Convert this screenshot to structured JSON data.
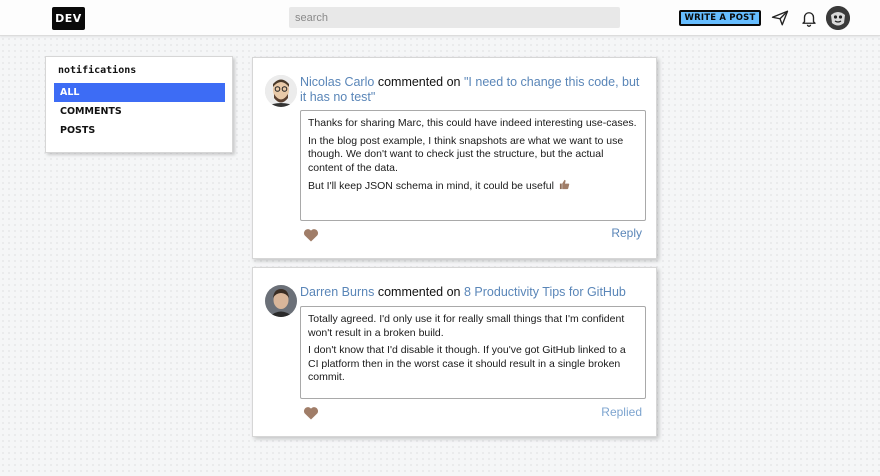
{
  "topbar": {
    "logo": "DEV",
    "search_placeholder": "search",
    "write_post_label": "WRITE A POST",
    "icons": [
      "send-icon",
      "bell-icon",
      "user-avatar"
    ]
  },
  "sidebar": {
    "title": "notifications",
    "items": [
      {
        "label": "ALL",
        "active": true
      },
      {
        "label": "COMMENTS",
        "active": false
      },
      {
        "label": "POSTS",
        "active": false
      }
    ]
  },
  "notifications": [
    {
      "author": "Nicolas Carlo",
      "action": "commented on",
      "post_title": "\"I need to change this code, but it has no test\"",
      "comment_paragraphs": [
        "Thanks for sharing Marc, this could have indeed interesting use-cases.",
        "In the blog post example, I think snapshots are what we want to use though. We don't want to check just the structure, but the actual content of the data.",
        "But I'll keep JSON schema in mind, it could be useful"
      ],
      "reply_label": "Reply"
    },
    {
      "author": "Darren Burns",
      "action": "commented on",
      "post_title": "8 Productivity Tips for GitHub",
      "comment_paragraphs": [
        "Totally agreed. I'd only use it for really small things that I'm confident won't result in a broken build.",
        "I don't know that I'd disable it though. If you've got GitHub linked to a CI platform then in the worst case it should result in a single broken commit."
      ],
      "reply_label": "Replied"
    }
  ],
  "colors": {
    "accent": "#3d6cf5",
    "link": "#5a86b8",
    "write_button": "#66bdff",
    "heart": "#a07d68"
  }
}
